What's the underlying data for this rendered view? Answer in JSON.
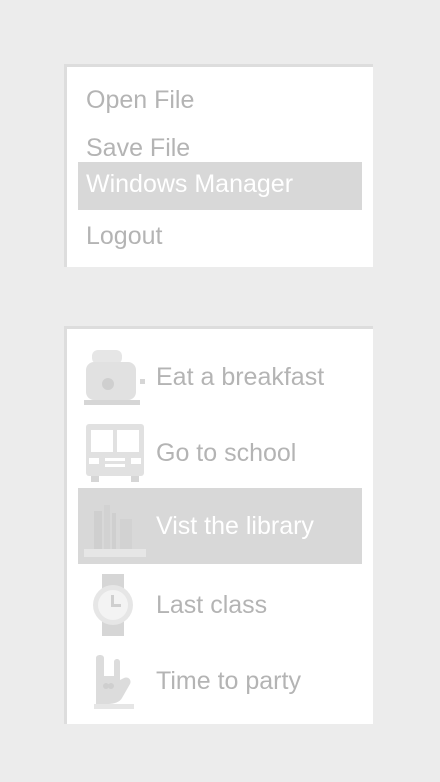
{
  "top_menu": {
    "items": [
      {
        "label": "Open File"
      },
      {
        "label": "Save File"
      },
      {
        "label": "Windows Manager"
      },
      {
        "label": "Logout"
      }
    ]
  },
  "bottom_menu": {
    "items": [
      {
        "label": "Eat a breakfast",
        "icon": "toaster-icon"
      },
      {
        "label": "Go to school",
        "icon": "bus-icon"
      },
      {
        "label": "Vist the library",
        "icon": "books-icon"
      },
      {
        "label": "Last class",
        "icon": "watch-icon"
      },
      {
        "label": "Time to party",
        "icon": "rock-hand-icon"
      }
    ]
  },
  "colors": {
    "background": "#ececec",
    "panel": "#ffffff",
    "active_bg": "#d8d8d8",
    "text": "#b4b4b4",
    "active_text": "#ffffff"
  }
}
